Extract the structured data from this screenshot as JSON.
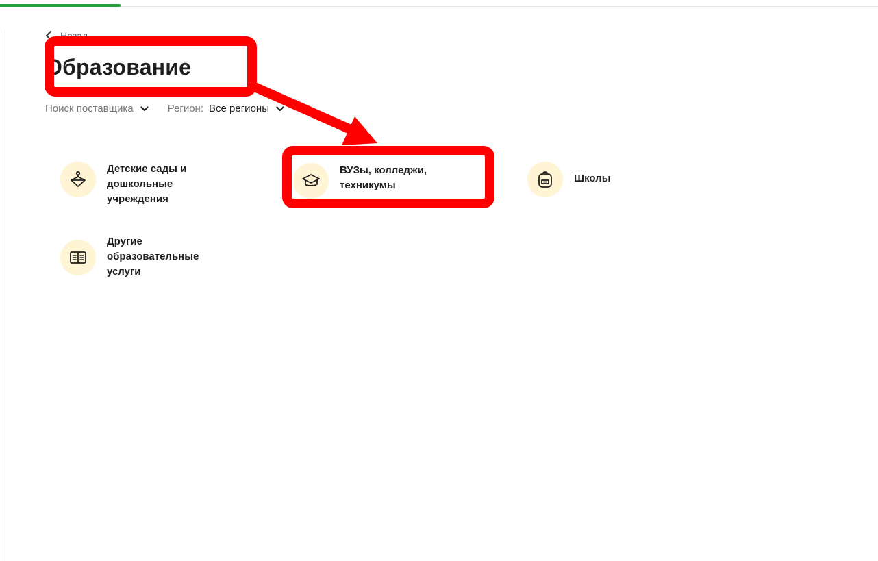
{
  "colors": {
    "accent_green": "#21a038",
    "icon_bg": "#fff4d3",
    "annotation_red": "#ff0000"
  },
  "back": {
    "label": "Назад",
    "icon": "chevron-left-icon"
  },
  "page": {
    "title": "Образование"
  },
  "filters": {
    "supplier_search": {
      "label": "Поиск поставщика",
      "icon": "chevron-down-icon"
    },
    "region": {
      "label": "Регион:",
      "value": "Все регионы",
      "icon": "chevron-down-icon"
    }
  },
  "categories": [
    {
      "label": "Детские сады и\nдошкольные\nучреждения",
      "icon": "spinning-top-icon"
    },
    {
      "label": "ВУЗы, колледжи,\nтехникумы",
      "icon": "graduation-cap-icon"
    },
    {
      "label": "Школы",
      "icon": "backpack-icon"
    },
    {
      "label": "Другие\nобразовательные\nуслуги",
      "icon": "open-book-icon"
    }
  ]
}
